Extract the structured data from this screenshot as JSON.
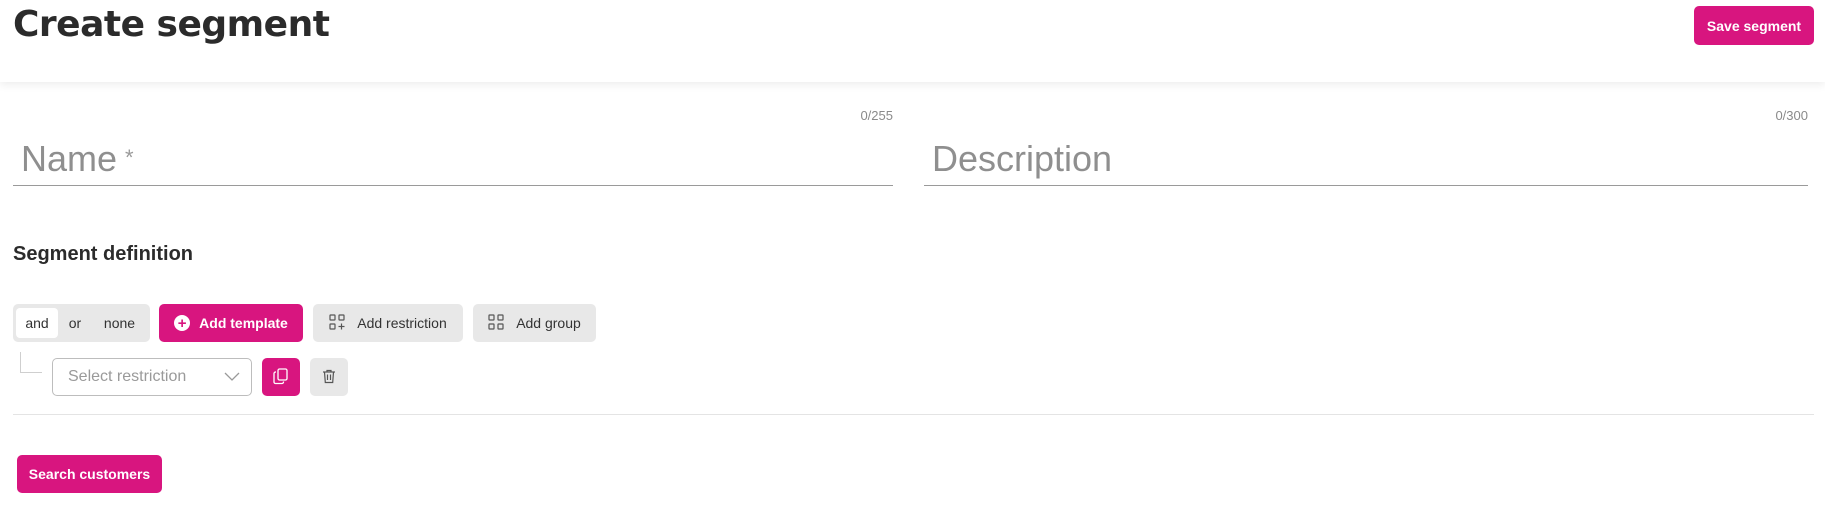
{
  "header": {
    "title": "Create segment",
    "save_label": "Save segment"
  },
  "form": {
    "name": {
      "placeholder": "Name",
      "required_mark": "*",
      "counter": "0/255",
      "value": ""
    },
    "description": {
      "placeholder": "Description",
      "counter": "0/300",
      "value": ""
    }
  },
  "definition": {
    "title": "Segment definition",
    "logic_options": [
      {
        "label": "and",
        "selected": true
      },
      {
        "label": "or",
        "selected": false
      },
      {
        "label": "none",
        "selected": false
      }
    ],
    "add_template_label": "Add template",
    "add_restriction_label": "Add restriction",
    "add_group_label": "Add group",
    "restriction": {
      "select_placeholder": "Select restriction",
      "icons": [
        "chevron-down-icon",
        "copy-icon",
        "trash-icon"
      ]
    }
  },
  "footer": {
    "search_label": "Search customers"
  },
  "colors": {
    "accent": "#d8157f",
    "secondary_bg": "#e8e8e8"
  }
}
